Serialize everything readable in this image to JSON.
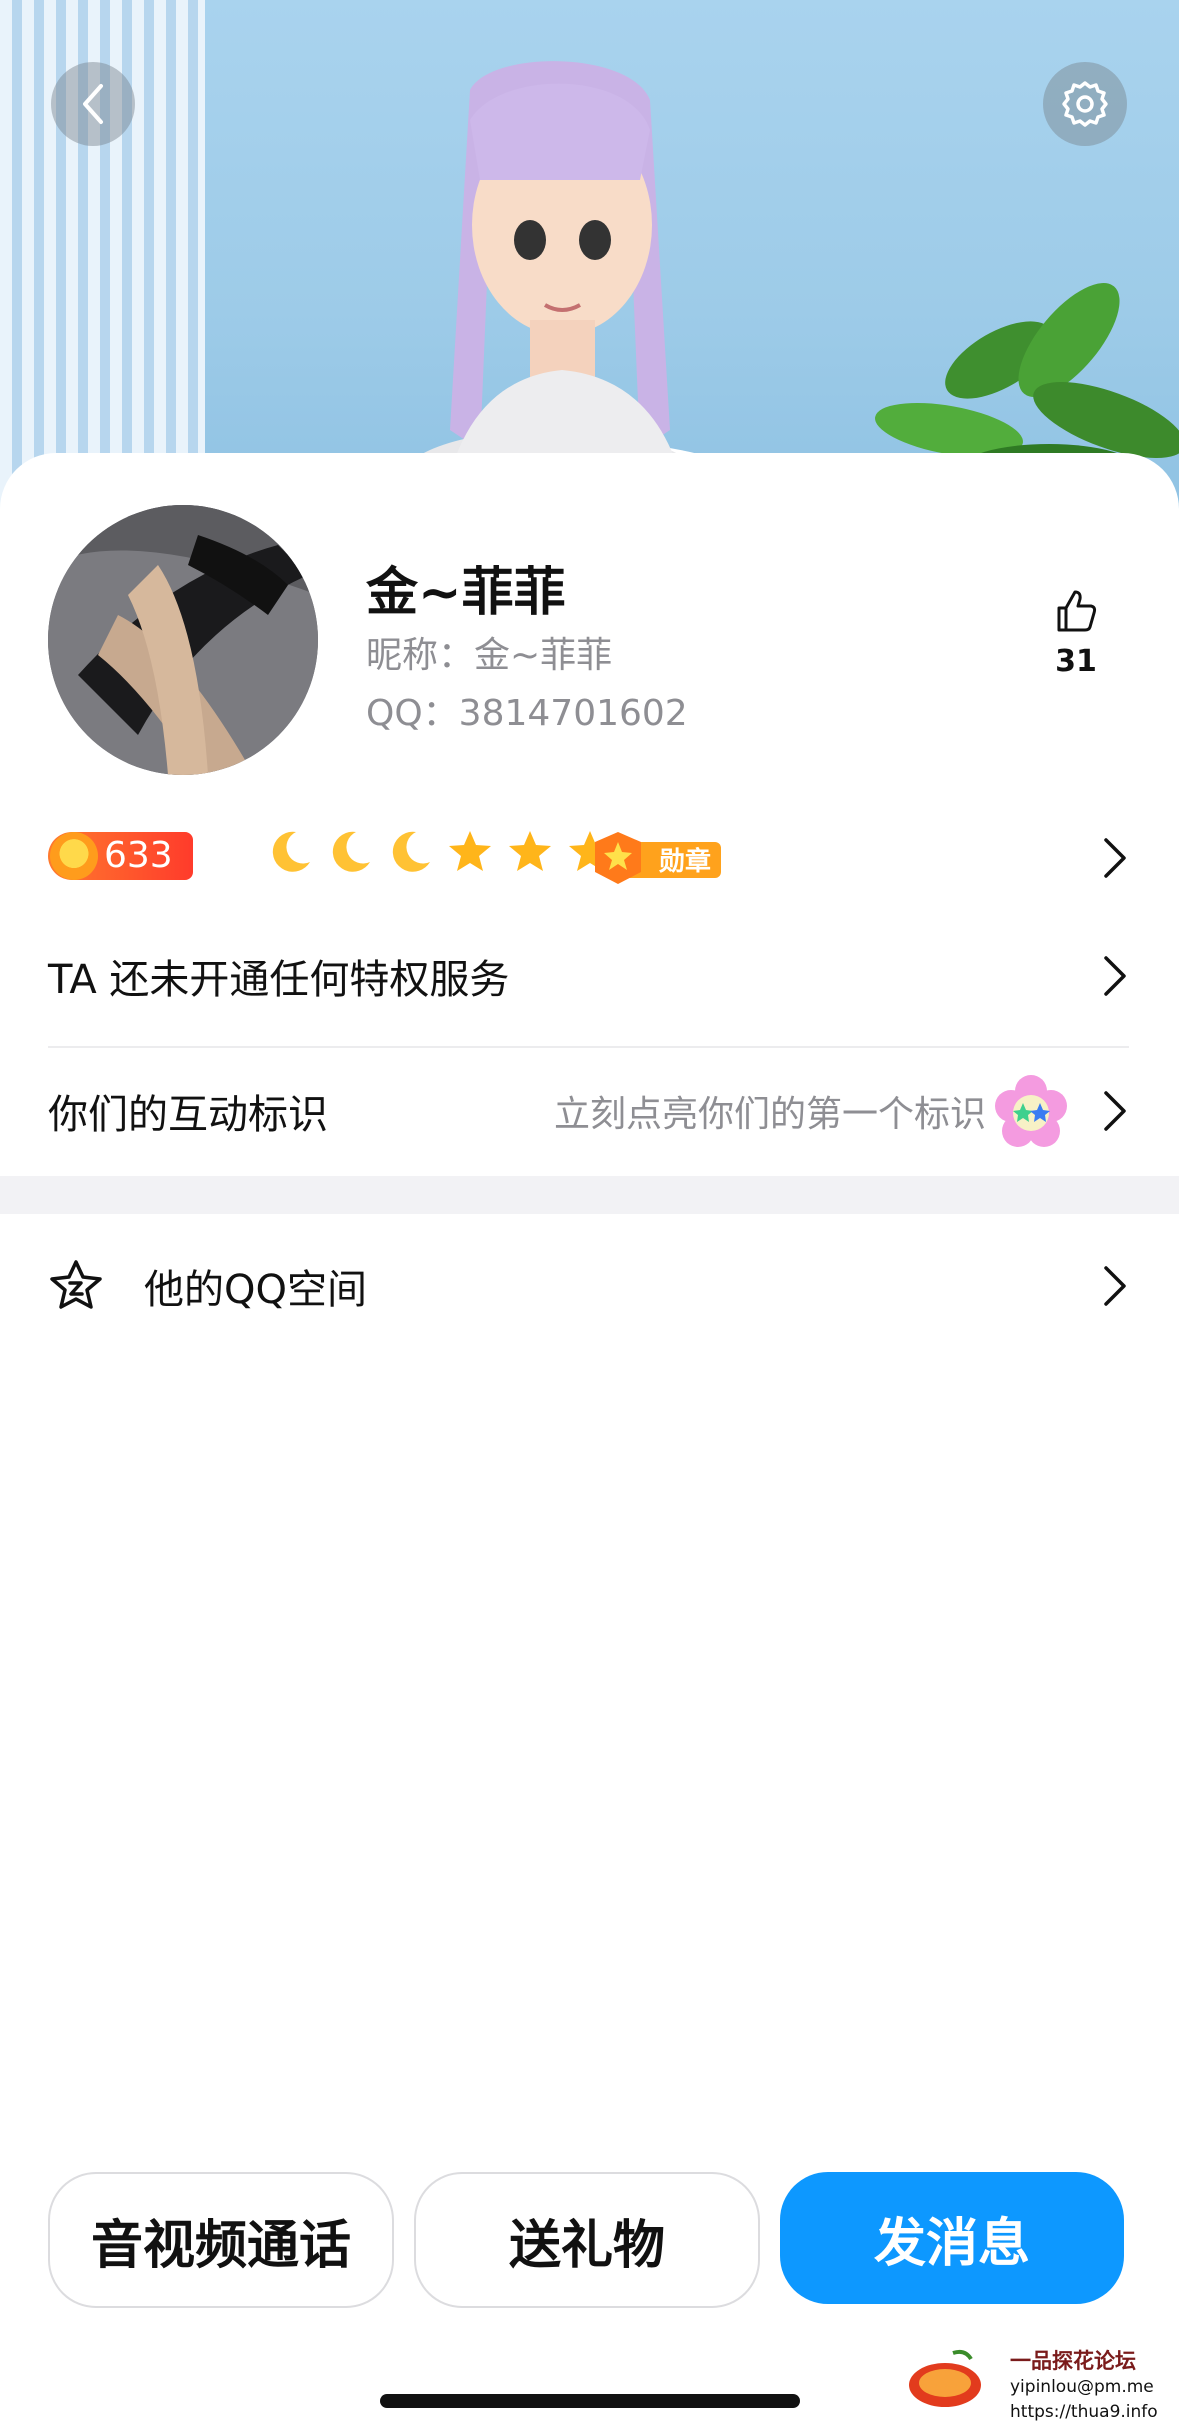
{
  "profile": {
    "display_name": "金~菲菲",
    "nickname_line": "昵称：金~菲菲",
    "qq_line": "QQ：3814701602",
    "likes": "31"
  },
  "level": {
    "value": "633",
    "icons": [
      "moon-icon",
      "moon-icon",
      "moon-icon",
      "star-icon",
      "star-icon",
      "star-icon"
    ],
    "medal_label": "勋章"
  },
  "rows": {
    "privilege": "TA 还未开通任何特权服务",
    "interaction_title": "你们的互动标识",
    "interaction_hint": "立刻点亮你们的第一个标识",
    "qzone": "他的QQ空间"
  },
  "buttons": {
    "call": "音视频通话",
    "gift": "送礼物",
    "message": "发消息"
  },
  "watermark": {
    "title": "一品探花论坛",
    "line1": "yipinlou@pm.me",
    "line2": "https://thua9.info"
  },
  "colors": {
    "primary": "#0d98ff",
    "level_badge": "#ff4a2b",
    "star": "#ffb51a"
  }
}
